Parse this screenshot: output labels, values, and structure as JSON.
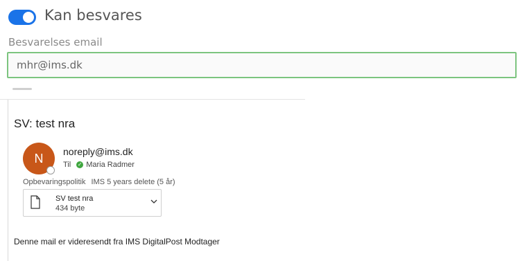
{
  "form": {
    "toggle_label": "Kan besvares",
    "field_label": "Besvarelses email",
    "email_value": "mhr@ims.dk"
  },
  "mail": {
    "subject": "SV: test nra",
    "avatar_initial": "N",
    "sender": "noreply@ims.dk",
    "to_label": "Til",
    "recipient": "Maria Radmer",
    "policy_label": "Opbevaringspolitik",
    "policy_value": "IMS 5 years delete (5 år)",
    "attachment": {
      "name": "SV test nra",
      "size": "434 byte"
    },
    "body": "Denne mail er videresendt fra IMS DigitalPost Modtager"
  },
  "colors": {
    "toggle_on": "#1a73e8",
    "field_border": "#7cc47f",
    "avatar": "#c85719",
    "check": "#3fa63f"
  }
}
